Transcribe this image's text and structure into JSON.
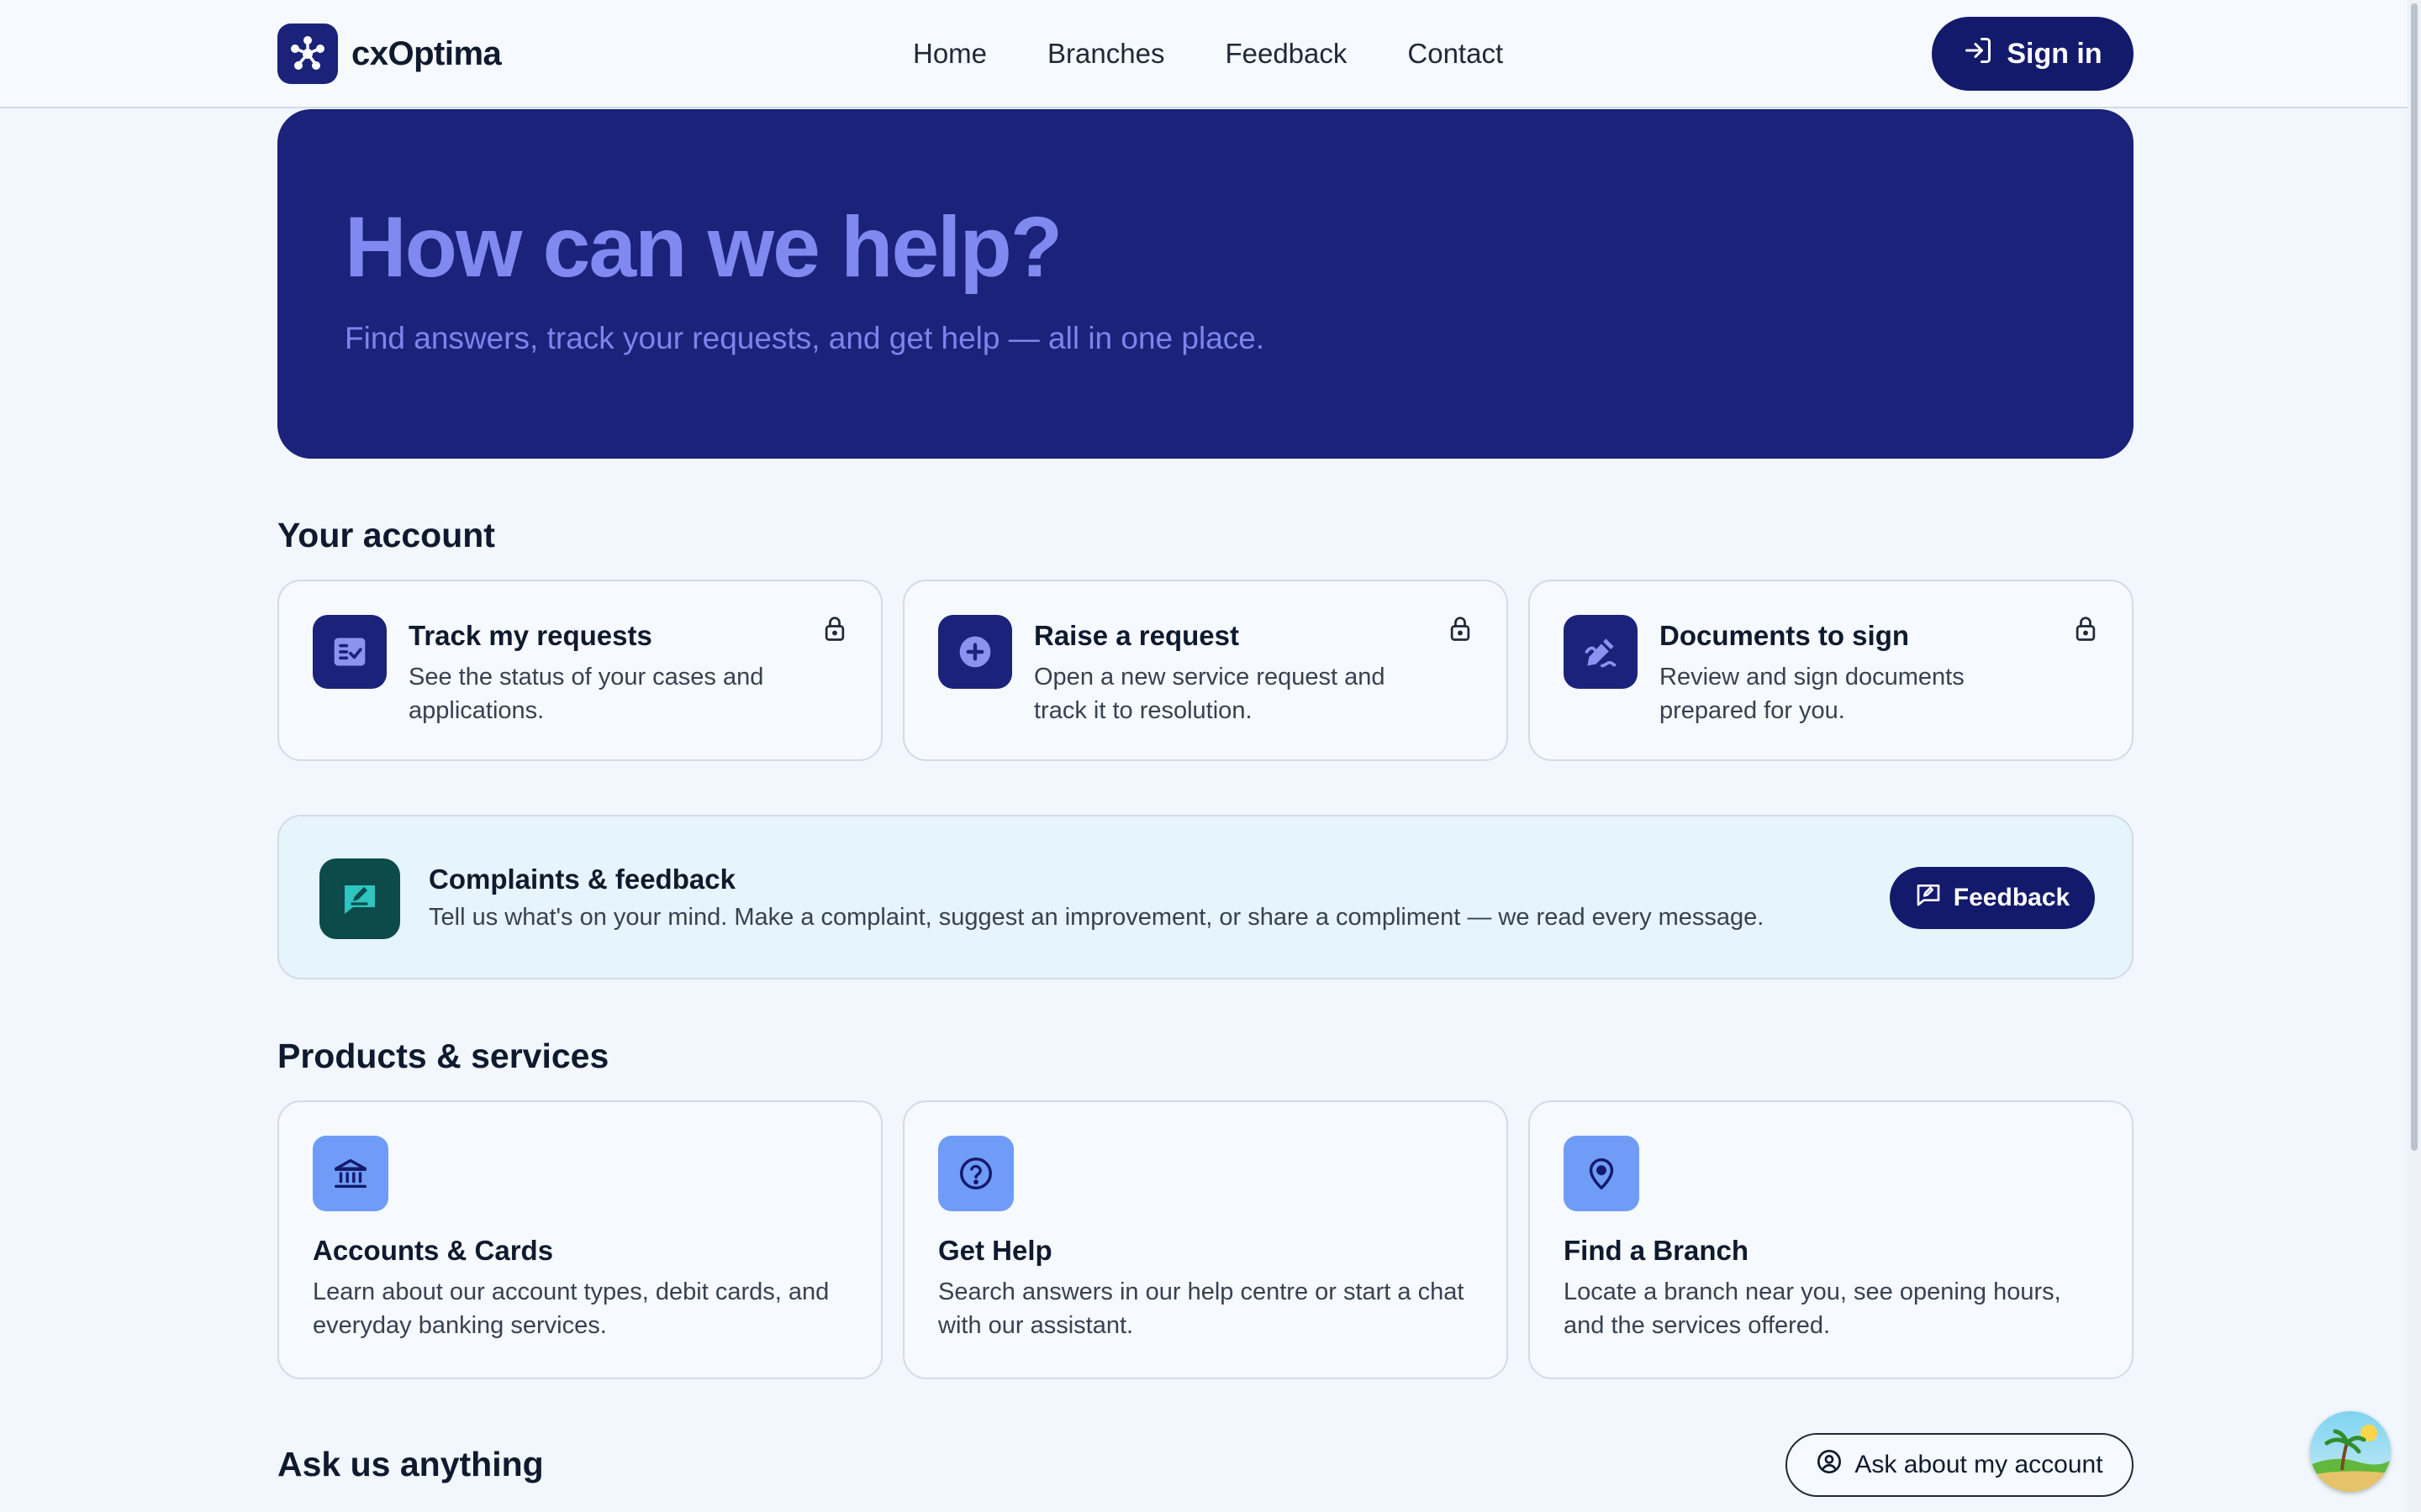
{
  "header": {
    "brand": "cxOptima",
    "nav": [
      "Home",
      "Branches",
      "Feedback",
      "Contact"
    ],
    "signin_label": "Sign in"
  },
  "hero": {
    "title": "How can we help?",
    "subtitle": "Find answers, track your requests, and get help — all in one place."
  },
  "account": {
    "heading": "Your account",
    "cards": [
      {
        "title": "Track my requests",
        "desc": "See the status of your cases and applications.",
        "icon": "checklist-icon"
      },
      {
        "title": "Raise a request",
        "desc": "Open a new service request and track it to resolution.",
        "icon": "plus-circle-icon"
      },
      {
        "title": "Documents to sign",
        "desc": "Review and sign documents prepared for you.",
        "icon": "signature-pen-icon"
      }
    ]
  },
  "complaints": {
    "title": "Complaints & feedback",
    "desc": "Tell us what's on your mind. Make a complaint, suggest an improvement, or share a compliment — we read every message.",
    "button_label": "Feedback"
  },
  "products": {
    "heading": "Products & services",
    "cards": [
      {
        "title": "Accounts & Cards",
        "desc": "Learn about our account types, debit cards, and everyday banking services.",
        "icon": "bank-icon"
      },
      {
        "title": "Get Help",
        "desc": "Search answers in our help centre or start a chat with our assistant.",
        "icon": "question-circle-icon"
      },
      {
        "title": "Find a Branch",
        "desc": "Locate a branch near you, see opening hours, and the services offered.",
        "icon": "map-pin-icon"
      }
    ]
  },
  "ask": {
    "heading": "Ask us anything",
    "button_label": "Ask about my account"
  },
  "colors": {
    "primary": "#1b227a",
    "button": "#141a6b",
    "hero_text": "#8089ef",
    "product_icon_bg": "#6f9cf7",
    "complaint_icon_bg": "#0d4a4a"
  }
}
